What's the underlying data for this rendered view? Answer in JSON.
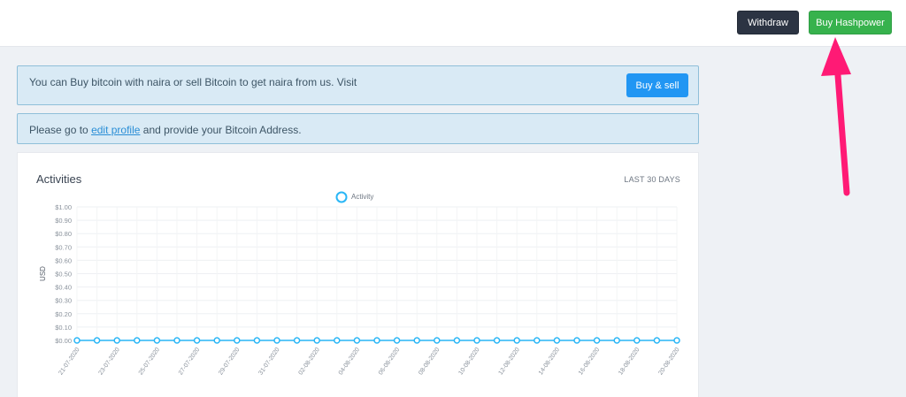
{
  "header": {
    "withdraw_label": "Withdraw",
    "buy_hashpower_label": "Buy Hashpower"
  },
  "alerts": {
    "buy_text": "You can Buy bitcoin with naira or sell Bitcoin to get naira from us. Visit",
    "buy_sell_label": "Buy & sell",
    "profile_prefix": "Please go to ",
    "profile_link": "edit profile",
    "profile_suffix": " and provide your Bitcoin Address."
  },
  "activities": {
    "title": "Activities",
    "range_label": "LAST 30 DAYS"
  },
  "chart_data": {
    "type": "line",
    "ylabel": "USD",
    "ylim": [
      0,
      1
    ],
    "yticks": [
      "$1.00",
      "$0.90",
      "$0.80",
      "$0.70",
      "$0.60",
      "$0.50",
      "$0.40",
      "$0.30",
      "$0.20",
      "$0.10",
      "$0.00"
    ],
    "x": [
      "21-07-2020",
      "22-07-2020",
      "23-07-2020",
      "24-07-2020",
      "25-07-2020",
      "26-07-2020",
      "27-07-2020",
      "28-07-2020",
      "29-07-2020",
      "30-07-2020",
      "31-07-2020",
      "01-08-2020",
      "02-08-2020",
      "03-08-2020",
      "04-08-2020",
      "05-08-2020",
      "06-08-2020",
      "07-08-2020",
      "08-08-2020",
      "09-08-2020",
      "10-08-2020",
      "11-08-2020",
      "12-08-2020",
      "13-08-2020",
      "14-08-2020",
      "15-08-2020",
      "16-08-2020",
      "17-08-2020",
      "18-08-2020",
      "19-08-2020",
      "20-08-2020"
    ],
    "xtick_labels": [
      "21-07-2020",
      "23-07-2020",
      "25-07-2020",
      "27-07-2020",
      "29-07-2020",
      "31-07-2020",
      "02-08-2020",
      "04-08-2020",
      "06-08-2020",
      "08-08-2020",
      "10-08-2020",
      "12-08-2020",
      "14-08-2020",
      "16-08-2020",
      "18-08-2020",
      "20-08-2020"
    ],
    "series": [
      {
        "name": "Activity",
        "color": "#29b6f6",
        "values": [
          0,
          0,
          0,
          0,
          0,
          0,
          0,
          0,
          0,
          0,
          0,
          0,
          0,
          0,
          0,
          0,
          0,
          0,
          0,
          0,
          0,
          0,
          0,
          0,
          0,
          0,
          0,
          0,
          0,
          0,
          0
        ]
      }
    ],
    "grid": true,
    "legend": "top-center"
  },
  "colors": {
    "annotation_arrow": "#ff1a75"
  }
}
